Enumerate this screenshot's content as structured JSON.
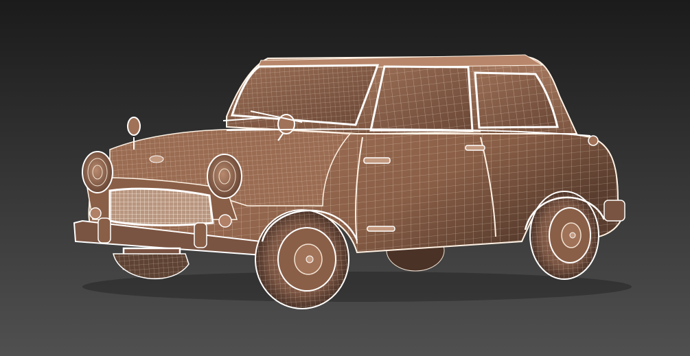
{
  "scene": {
    "subject": "wireframe-car-model",
    "colors": {
      "background_top": "#1b1b1b",
      "background_bottom": "#505050",
      "body_fill": "#8a5f47",
      "body_light": "#b07f63",
      "body_dark": "#4e3427",
      "glass_fill": "#7a5643",
      "wire": "#f3e3d3",
      "edge_highlight": "#ffffff",
      "tire": "#5e4334",
      "plate": "#7a5242"
    }
  }
}
